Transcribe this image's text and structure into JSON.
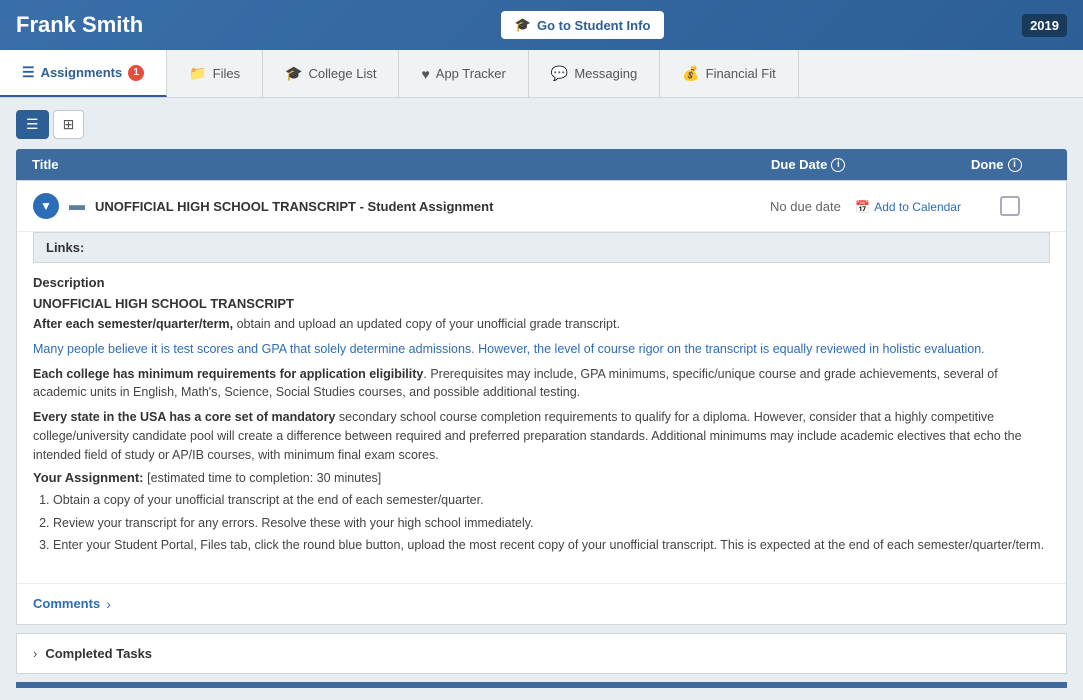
{
  "header": {
    "student_name": "Frank Smith",
    "student_info_btn": "Go to Student Info",
    "year": "2019",
    "cap_icon": "🎓"
  },
  "tabs": [
    {
      "id": "assignments",
      "label": "Assignments",
      "icon": "☰",
      "active": true,
      "badge": "1"
    },
    {
      "id": "files",
      "label": "Files",
      "icon": "📁",
      "active": false
    },
    {
      "id": "college-list",
      "label": "College List",
      "icon": "🎓",
      "active": false
    },
    {
      "id": "app-tracker",
      "label": "App Tracker",
      "icon": "❤",
      "active": false
    },
    {
      "id": "messaging",
      "label": "Messaging",
      "icon": "💬",
      "active": false
    },
    {
      "id": "financial-fit",
      "label": "Financial Fit",
      "icon": "💰",
      "active": false
    }
  ],
  "view_toggle": {
    "list_icon": "☰",
    "grid_icon": "⊞"
  },
  "table_header": {
    "title_col": "Title",
    "due_date_col": "Due Date",
    "done_col": "Done"
  },
  "assignment": {
    "title": "UNOFFICIAL HIGH SCHOOL TRANSCRIPT - Student Assignment",
    "due_date": "No due date",
    "add_calendar": "Add to Calendar",
    "calendar_icon": "📅",
    "links_label": "Links:",
    "description_label": "Description",
    "transcript_title": "UNOFFICIAL HIGH SCHOOL TRANSCRIPT",
    "para1_bold": "After each semester/quarter/term,",
    "para1_rest": " obtain and upload an updated copy of your unofficial grade transcript.",
    "para2": "Many people believe it is test scores and GPA that solely determine admissions. However, the level of course rigor on the transcript is equally reviewed in holistic evaluation.",
    "para3_bold": "Each college has minimum requirements for application eligibility",
    "para3_rest": ". Prerequisites may include, GPA minimums, specific/unique course and grade achievements, several of academic units in English, Math's, Science, Social Studies courses, and possible additional testing.",
    "para4_bold": "Every state in the USA has a core set of mandatory",
    "para4_rest": " secondary school course completion requirements to qualify for a diploma. However, consider that a highly competitive college/university candidate pool will create a difference between required and preferred preparation standards. Additional minimums may include academic electives that echo the intended field of study or AP/IB courses, with minimum final exam scores.",
    "your_assignment_label": "Your Assignment:",
    "your_assignment_note": "[estimated time to completion: 30 minutes]",
    "steps": [
      "Obtain a copy of your unofficial transcript at the end of each semester/quarter.",
      "Review your transcript for any errors. Resolve these with your high school immediately.",
      "Enter your Student Portal, Files tab, click the round blue button, upload the most recent copy of your unofficial transcript. This is expected at the end of each semester/quarter/term."
    ],
    "comments_label": "Comments",
    "completed_tasks_label": "Completed Tasks"
  }
}
